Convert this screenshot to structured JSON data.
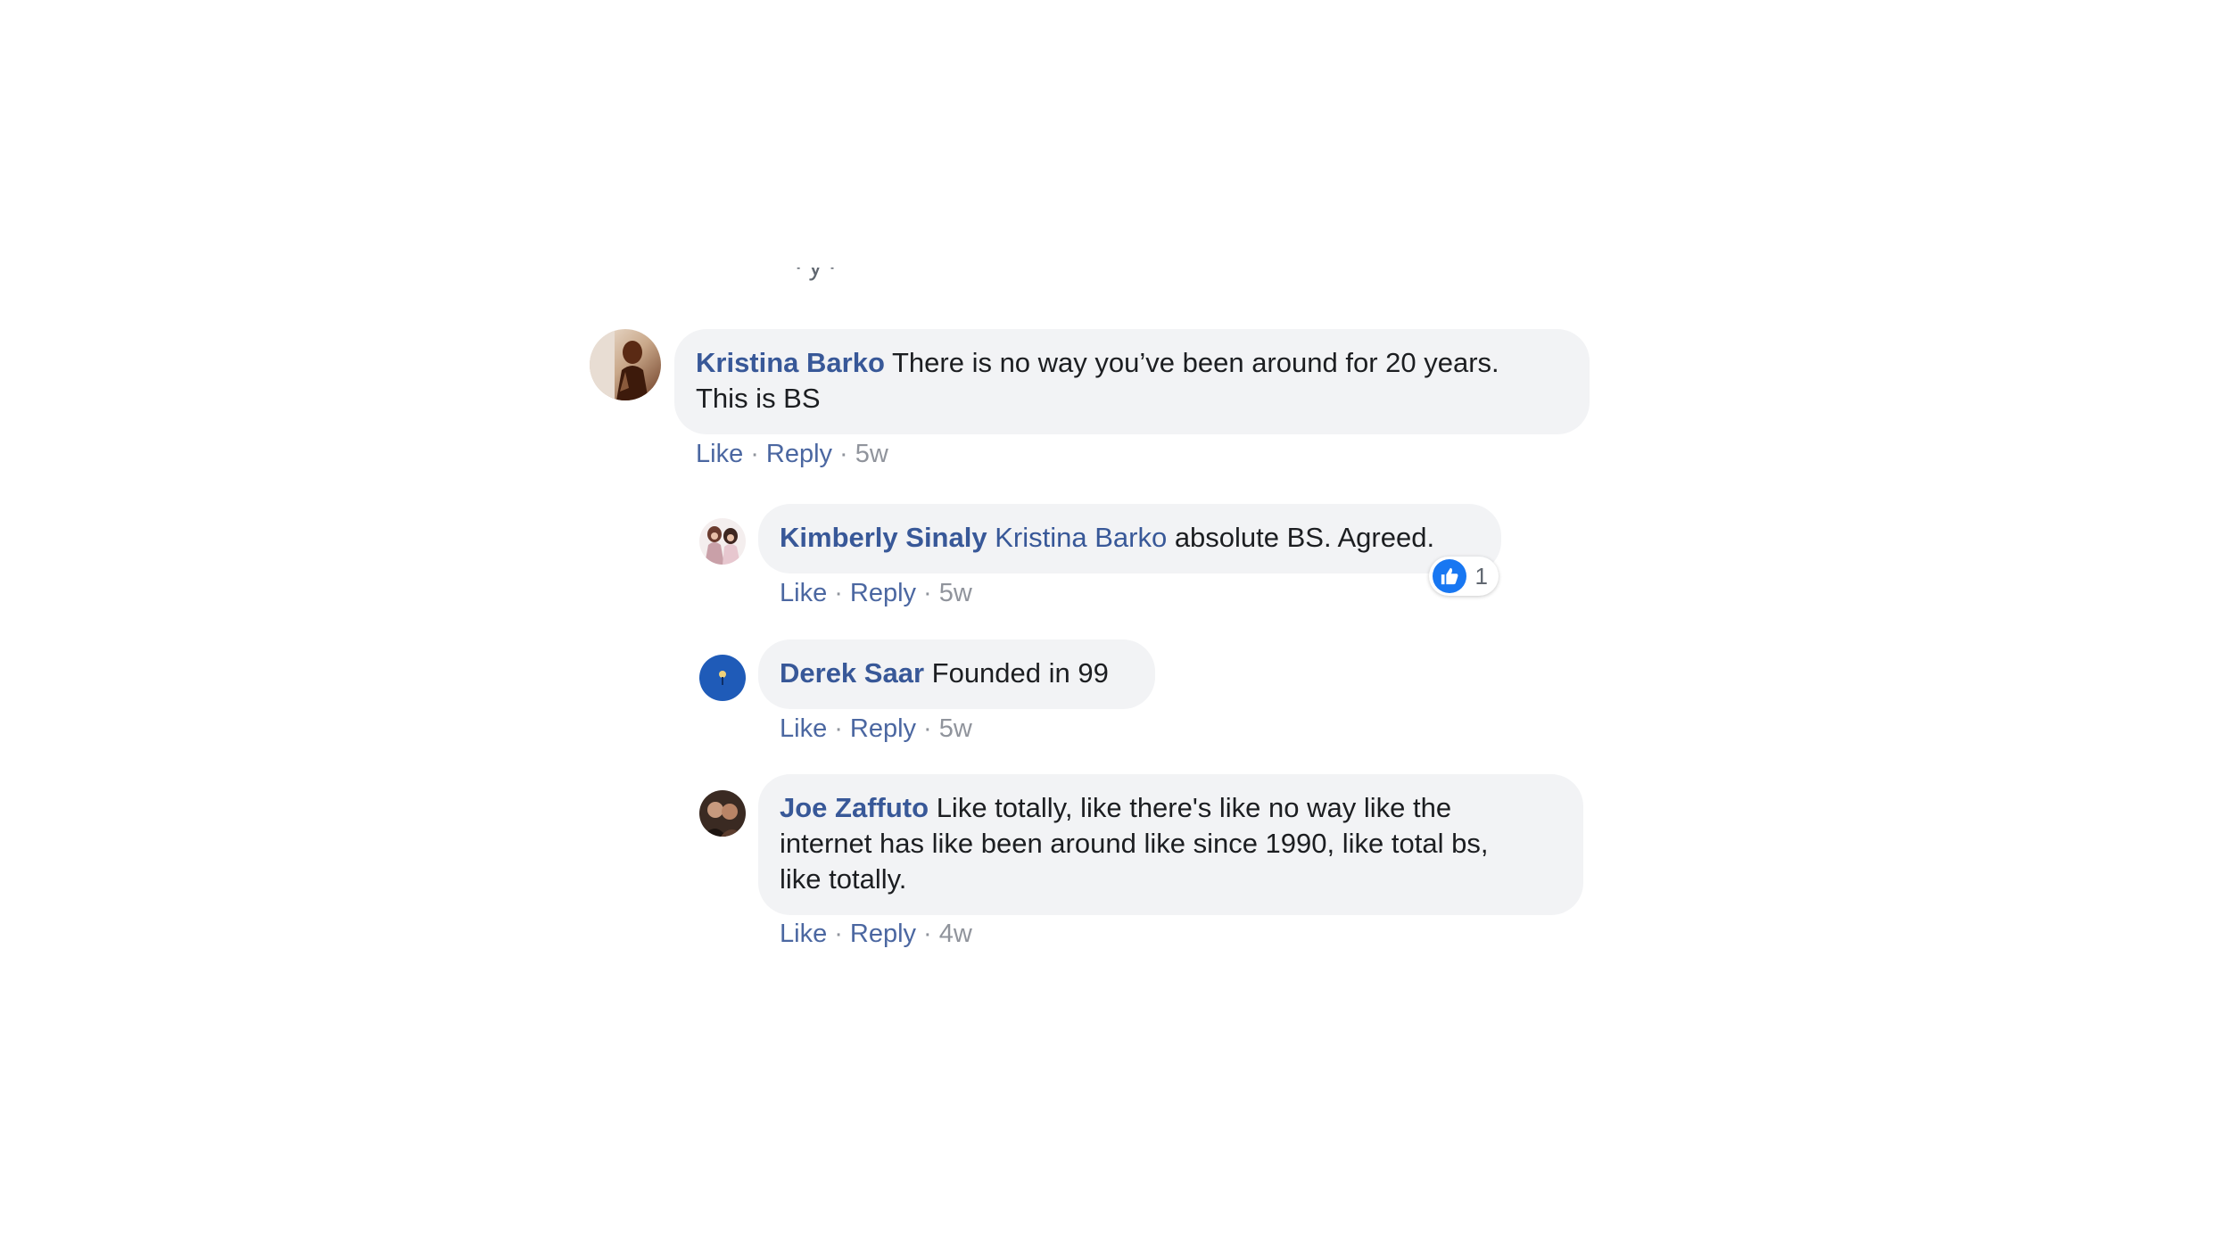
{
  "comments": [
    {
      "author": "Kristina Barko",
      "text_line1": "There is no way you’ve been around for 20 years.",
      "text_line2": "This is BS",
      "like_label": "Like",
      "reply_label": "Reply",
      "time": "5w"
    },
    {
      "author": "Kimberly Sinaly",
      "mention": "Kristina Barko",
      "text": "absolute BS. Agreed.",
      "like_label": "Like",
      "reply_label": "Reply",
      "time": "5w",
      "reaction_icon": "thumbs-up-icon",
      "reaction_count": "1"
    },
    {
      "author": "Derek Saar",
      "text": "Founded in 99",
      "like_label": "Like",
      "reply_label": "Reply",
      "time": "5w"
    },
    {
      "author": "Joe Zaffuto",
      "text_line1": "Like totally, like there's like no way like the",
      "text_line2": "internet has like been around like since 1990, like total bs,",
      "text_line3": "like totally.",
      "like_label": "Like",
      "reply_label": "Reply",
      "time": "4w"
    }
  ],
  "colors": {
    "link": "#385898",
    "bubble": "#f2f3f5",
    "meta": "#90949c",
    "like_blue": "#1877f2"
  }
}
